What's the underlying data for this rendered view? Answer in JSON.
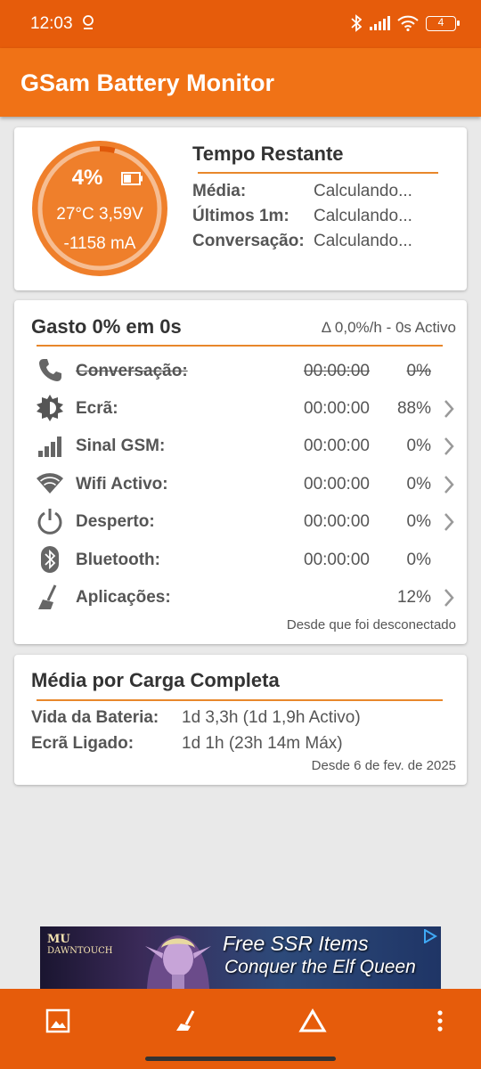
{
  "status_bar": {
    "time": "12:03",
    "battery_level": "4"
  },
  "app_bar": {
    "title": "GSam Battery Monitor"
  },
  "battery_gauge": {
    "percent": "4%",
    "level_fraction": 0.04,
    "temp_voltage": "27°C  3,59V",
    "current": "-1158 mA"
  },
  "remaining": {
    "title": "Tempo Restante",
    "rows": [
      {
        "label": "Média:",
        "value": "Calculando..."
      },
      {
        "label": "Últimos 1m:",
        "value": "Calculando..."
      },
      {
        "label": "Conversação:",
        "value": "Calculando..."
      }
    ]
  },
  "usage": {
    "title": "Gasto 0% em 0s",
    "rate": "Δ 0,0%/h - 0s Activo",
    "rows": [
      {
        "icon": "phone-icon",
        "label": "Conversação:",
        "time": "00:00:00",
        "percent": "0%"
      },
      {
        "icon": "screen-brightness-icon",
        "label": "Ecrã:",
        "time": "00:00:00",
        "percent": "88%"
      },
      {
        "icon": "signal-bars-icon",
        "label": "Sinal GSM:",
        "time": "00:00:00",
        "percent": "0%"
      },
      {
        "icon": "wifi-icon",
        "label": "Wifi Activo:",
        "time": "00:00:00",
        "percent": "0%"
      },
      {
        "icon": "power-icon",
        "label": "Desperto:",
        "time": "00:00:00",
        "percent": "0%"
      },
      {
        "icon": "bluetooth-icon",
        "label": "Bluetooth:",
        "time": "00:00:00",
        "percent": "0%"
      },
      {
        "icon": "broom-icon",
        "label": "Aplicações:",
        "time": "",
        "percent": "12%"
      }
    ],
    "footer": "Desde que foi desconectado"
  },
  "full_charge": {
    "title": "Média por Carga Completa",
    "rows": [
      {
        "label": "Vida da Bateria:",
        "value": "1d 3,3h (1d 1,9h Activo)"
      },
      {
        "label": "Ecrã Ligado:",
        "value": "1d 1h (23h 14m Máx)"
      }
    ],
    "footer": "Desde 6 de fev. de 2025"
  },
  "ad": {
    "brand_line1": "MU",
    "brand_line2": "DAWNTOUCH",
    "line1": "Free SSR Items",
    "line2": "Conquer the Elf Queen"
  },
  "colors": {
    "status_bar": "#e65c0b",
    "app_bar": "#f07216",
    "accent": "#e8872b",
    "bottom_bar": "#e65c0b"
  },
  "bottom_nav": [
    "image-icon",
    "broom-icon",
    "triangle-icon",
    "more-vert-icon"
  ]
}
